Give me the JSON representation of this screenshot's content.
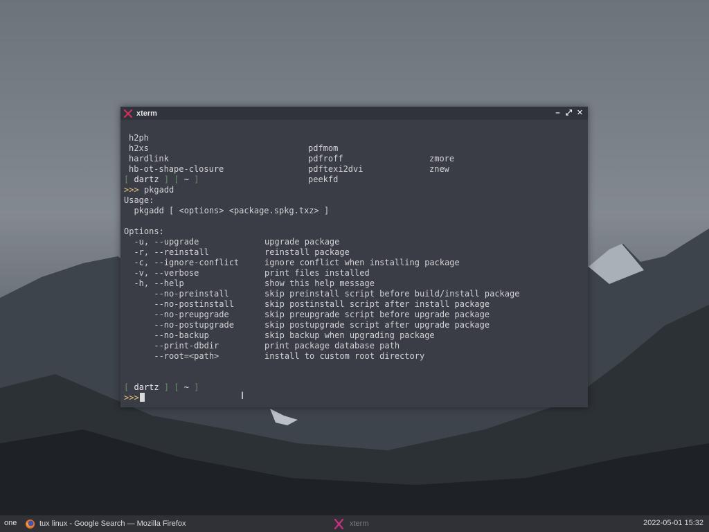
{
  "window": {
    "title": "xterm",
    "buttons": {
      "minimize": "–",
      "restore": "⤢",
      "close": "✕"
    }
  },
  "terminal": {
    "ls_rows": [
      [
        "h2ph",
        "pdfmom",
        "zmore"
      ],
      [
        "h2xs",
        "pdfroff",
        "znew"
      ],
      [
        "hardlink",
        "pdftexi2dvi",
        ""
      ],
      [
        "hb-ot-shape-closure",
        "peekfd",
        ""
      ]
    ],
    "prompt": {
      "open": "[",
      "user": "dartz",
      "close": "]",
      "dir_open": "[",
      "dir": "~",
      "dir_close": "]",
      "symbol": ">>>"
    },
    "command": "pkgadd",
    "usage_label": "Usage:",
    "usage_line": "  pkgadd [ <options> <package.spkg.txz> ]",
    "options_label": "Options:",
    "options": [
      {
        "flag": "  -u, --upgrade",
        "desc": "upgrade package"
      },
      {
        "flag": "  -r, --reinstall",
        "desc": "reinstall package"
      },
      {
        "flag": "  -c, --ignore-conflict",
        "desc": "ignore conflict when installing package"
      },
      {
        "flag": "  -v, --verbose",
        "desc": "print files installed"
      },
      {
        "flag": "  -h, --help",
        "desc": "show this help message"
      },
      {
        "flag": "      --no-preinstall",
        "desc": "skip preinstall script before build/install package"
      },
      {
        "flag": "      --no-postinstall",
        "desc": "skip postinstall script after install package"
      },
      {
        "flag": "      --no-preupgrade",
        "desc": "skip preupgrade script before upgrade package"
      },
      {
        "flag": "      --no-postupgrade",
        "desc": "skip postupgrade script after upgrade package"
      },
      {
        "flag": "      --no-backup",
        "desc": "skip backup when upgrading package"
      },
      {
        "flag": "      --print-dbdir",
        "desc": "print package database path"
      },
      {
        "flag": "      --root=<path>",
        "desc": "install to custom root directory"
      }
    ],
    "colors": {
      "background": "#3a3c46",
      "text": "#d3d3d3",
      "prompt_yellow": "#e4c27a",
      "bracket_green": "#6a8f6a"
    }
  },
  "taskbar": {
    "workspace": "one",
    "tasks": [
      {
        "icon": "firefox-icon",
        "label": "tux linux - Google Search — Mozilla Firefox"
      },
      {
        "icon": "xterm-icon",
        "label": "xterm"
      }
    ],
    "clock": "2022-05-01 15:32"
  }
}
